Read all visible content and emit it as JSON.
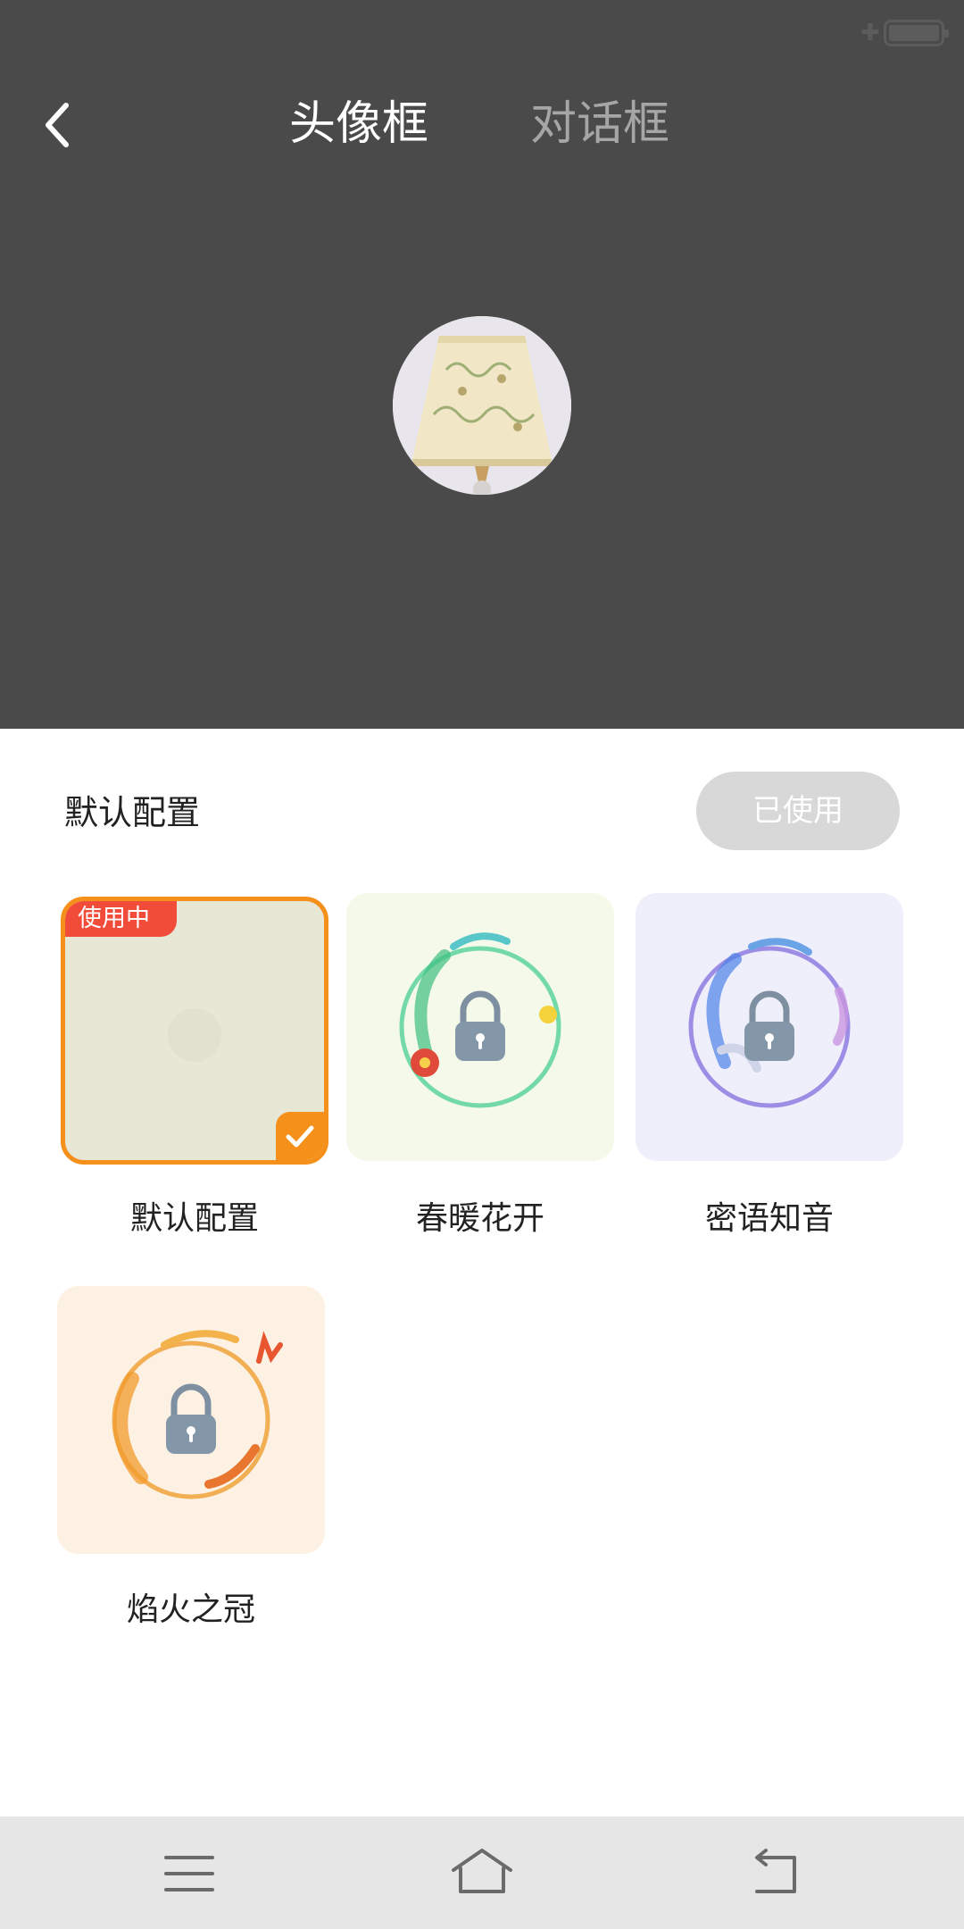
{
  "header": {
    "tabs": [
      {
        "label": "头像框",
        "active": true
      },
      {
        "label": "对话框",
        "active": false
      }
    ]
  },
  "section": {
    "title": "默认配置",
    "button_label": "已使用"
  },
  "frames": [
    {
      "name": "默认配置",
      "badge": "使用中",
      "selected": true,
      "locked": false
    },
    {
      "name": "春暖花开",
      "locked": true
    },
    {
      "name": "密语知音",
      "locked": true
    },
    {
      "name": "焰火之冠",
      "locked": true
    }
  ],
  "colors": {
    "header_bg": "#4a4a4a",
    "accent": "#f5901a",
    "badge": "#f14b3a",
    "nav_bg": "#e6e6e6"
  },
  "icons": [
    "back-arrow-icon",
    "lock-icon",
    "check-icon",
    "menu-icon",
    "home-icon",
    "return-icon"
  ]
}
